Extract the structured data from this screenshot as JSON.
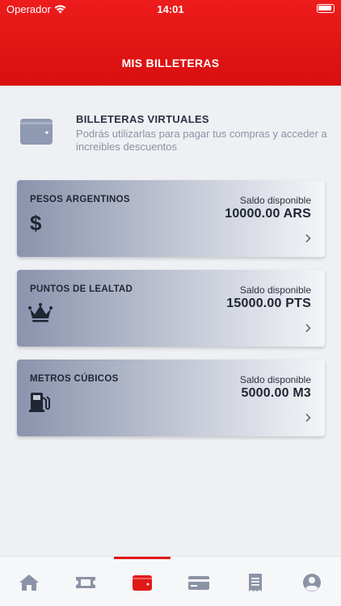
{
  "status_bar": {
    "carrier": "Operador",
    "time": "14:01"
  },
  "header": {
    "title": "MIS BILLETERAS"
  },
  "intro": {
    "icon": "wallet-icon",
    "title": "BILLETERAS VIRTUALES",
    "description": "Podrás utilizarlas para pagar tus compras y acceder a increibles descuentos"
  },
  "wallets": [
    {
      "name": "PESOS ARGENTINOS",
      "icon": "dollar-icon",
      "saldo_label": "Saldo disponible",
      "amount": "10000.00 ARS"
    },
    {
      "name": "PUNTOS DE LEALTAD",
      "icon": "crown-icon",
      "saldo_label": "Saldo disponible",
      "amount": "15000.00 PTS"
    },
    {
      "name": "METROS CÚBICOS",
      "icon": "gas-pump-icon",
      "saldo_label": "Saldo disponible",
      "amount": "5000.00 M3"
    }
  ],
  "tabbar": {
    "active_index": 2,
    "active_color": "#e01919",
    "inactive_color": "#8c93a6",
    "tabs": [
      "home-icon",
      "ticket-icon",
      "wallet-icon",
      "card-icon",
      "receipt-icon",
      "profile-icon"
    ]
  }
}
